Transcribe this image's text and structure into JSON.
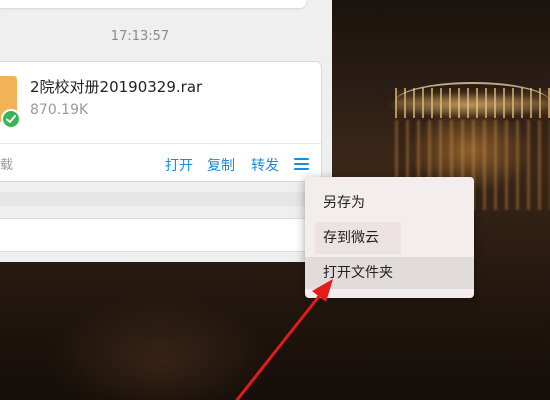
{
  "chat": {
    "timestamp": "17:13:57",
    "file_card": {
      "file_name": "2院校对册20190329.rar",
      "file_size": "870.19K",
      "partial_left_text": "载",
      "actions": {
        "open": "打开",
        "copy": "复制",
        "forward": "转发"
      },
      "menu_icon": "hamburger-icon",
      "status_icon": "check-icon"
    }
  },
  "context_menu": {
    "items": [
      {
        "label": "另存为"
      },
      {
        "label": "存到微云"
      },
      {
        "label": "打开文件夹"
      }
    ]
  },
  "colors": {
    "link_blue": "#1a8cd8",
    "arrow_red": "#e21b1b",
    "file_icon_orange": "#f2b256",
    "check_green": "#3cb455"
  }
}
